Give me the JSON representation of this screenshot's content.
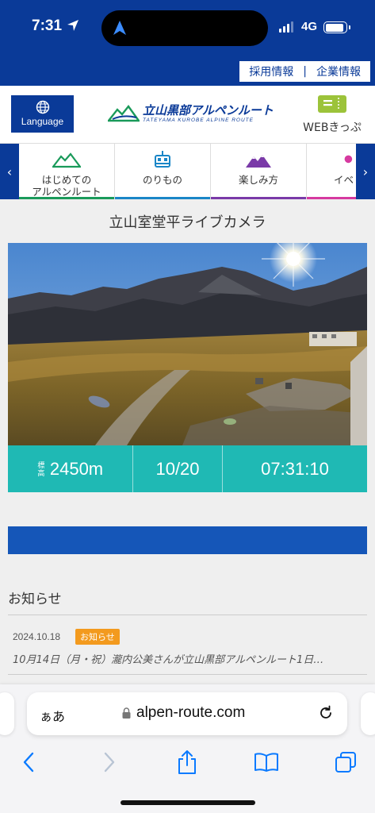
{
  "status_bar": {
    "time": "7:31",
    "network": "4G",
    "battery_level": 0.9
  },
  "top_links": {
    "recruit": "採用情報",
    "separator": "|",
    "company": "企業情報"
  },
  "header": {
    "language_label": "Language",
    "logo_text": "立山黒部アルペンルート",
    "logo_subtext": "TATEYAMA KUROBE ALPINE ROUTE",
    "ticket_label": "WEBきっぷ"
  },
  "nav": {
    "items": [
      {
        "label_line1": "はじめての",
        "label_line2": "アルペンルート",
        "color": "#1a9a5a"
      },
      {
        "label_line1": "のりもの",
        "label_line2": "",
        "color": "#1a86c7"
      },
      {
        "label_line1": "楽しみ方",
        "label_line2": "",
        "color": "#7a3aa8"
      },
      {
        "label_line1": "イベ",
        "label_line2": "",
        "color": "#d63aa0"
      }
    ]
  },
  "page": {
    "title": "立山室堂平ライブカメラ"
  },
  "camera_info": {
    "altitude_label": "標高",
    "altitude": "2450m",
    "date": "10/20",
    "time": "07:31:10"
  },
  "news": {
    "heading": "お知らせ",
    "items": [
      {
        "date": "2024.10.18",
        "badge": "お知らせ",
        "text": "10月14日（月・祝）瀧内公美さんが立山黒部アルペンルート1日…"
      }
    ]
  },
  "browser": {
    "aa_label": "ぁあ",
    "url": "alpen-route.com"
  },
  "colors": {
    "brand_blue": "#0a3a98",
    "teal": "#1fb9b4",
    "badge_orange": "#f39a1e",
    "ios_blue": "#0a7aff"
  }
}
